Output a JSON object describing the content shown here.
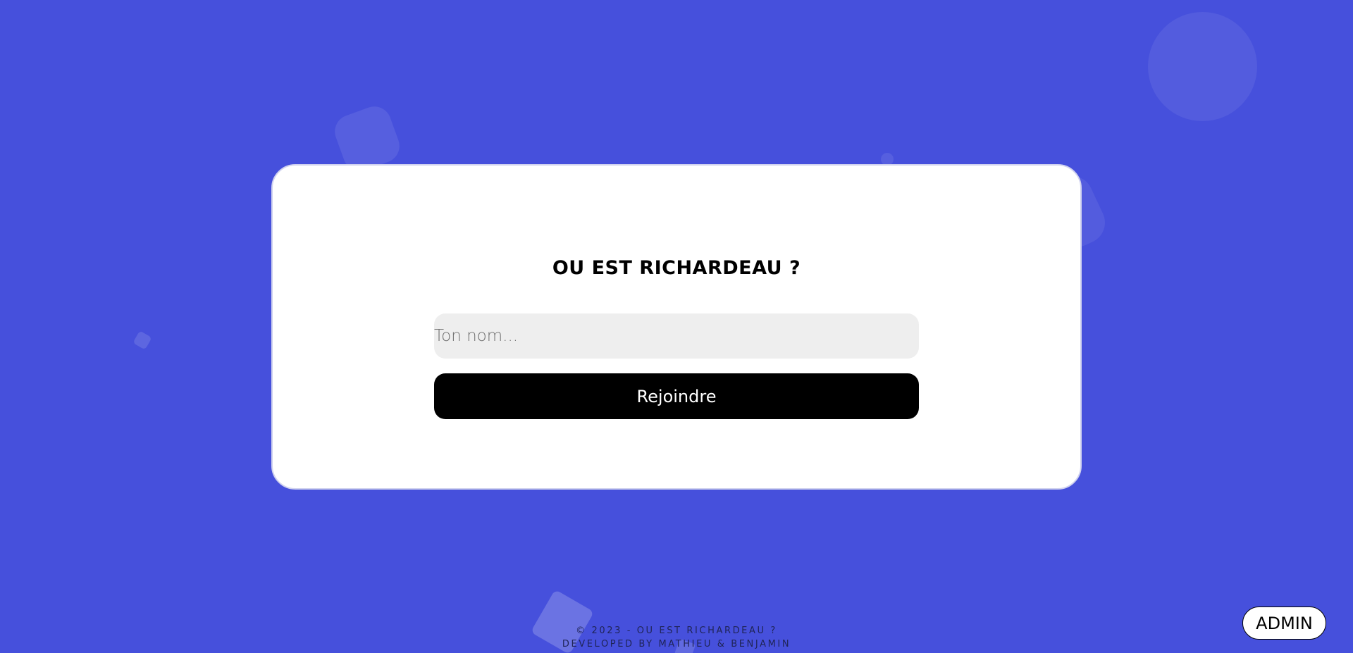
{
  "colors": {
    "background": "#4650dc",
    "card": "#ffffff",
    "input_background": "#eeeeee",
    "button_background": "#000000",
    "button_text": "#ffffff"
  },
  "card": {
    "title": "OU EST RICHARDEAU ?",
    "name_input": {
      "placeholder": "Ton nom...",
      "value": ""
    },
    "join_label": "Rejoindre"
  },
  "footer": {
    "copyright": "© 2023 - OU EST RICHARDEAU ?",
    "credits": "DEVELOPED BY MATHIEU & BENJAMIN"
  },
  "admin_label": "ADMIN"
}
